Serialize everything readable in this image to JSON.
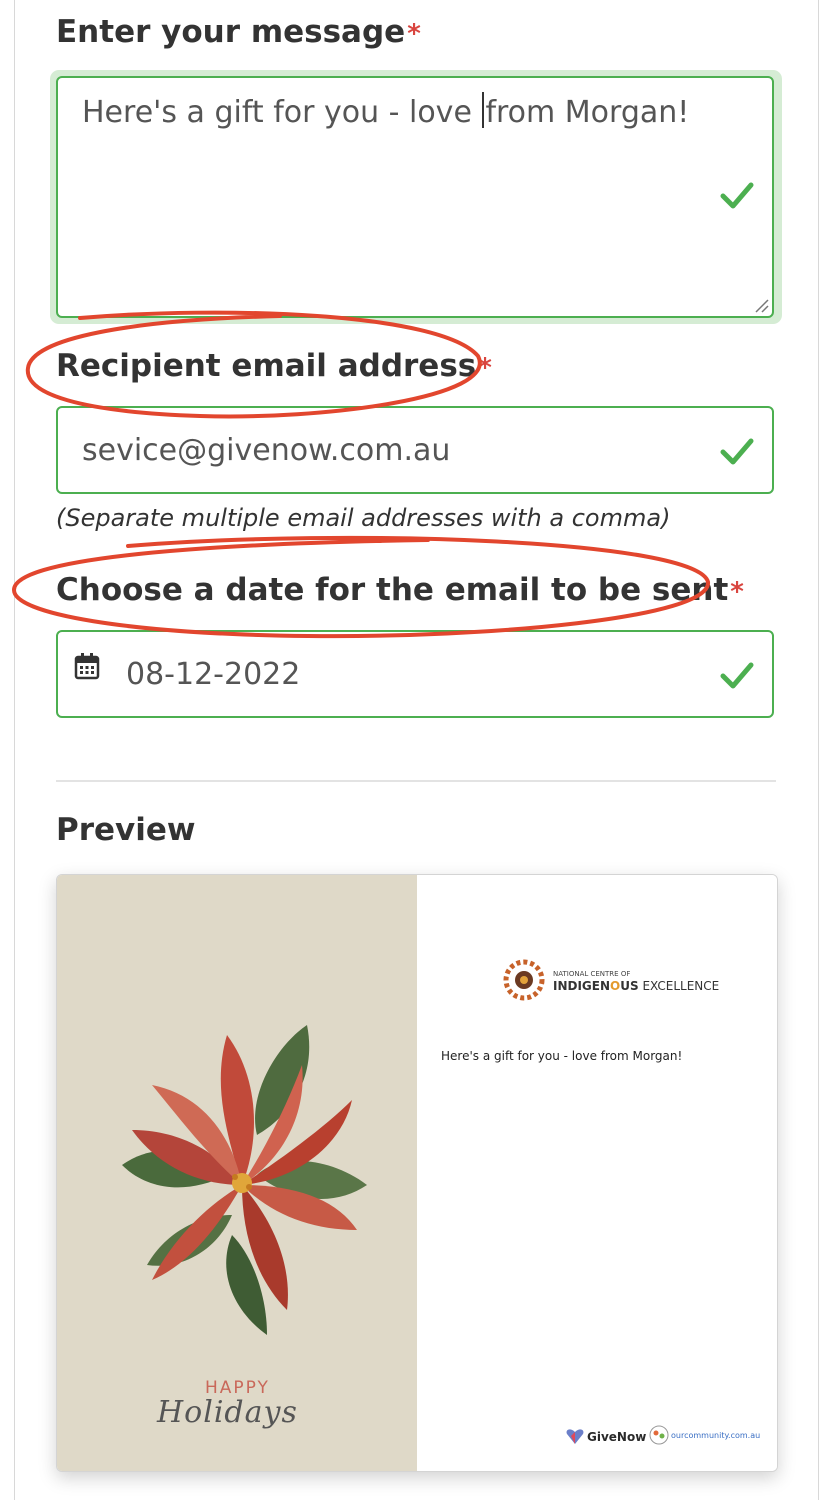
{
  "form": {
    "message": {
      "label": "Enter your message",
      "required_mark": "*",
      "value_before_caret": "Here's a gift for you - love ",
      "value_after_caret": "from Morgan!"
    },
    "recipient": {
      "label": "Recipient email address",
      "required_mark": "*",
      "value": "sevice@givenow.com.au",
      "hint": "(Separate multiple email addresses with a comma)"
    },
    "send_date": {
      "label": "Choose a date for the email to be sent",
      "required_mark": "*",
      "value": "08-12-2022"
    }
  },
  "preview": {
    "title": "Preview",
    "card": {
      "greeting_line1": "HAPPY",
      "greeting_line2": "Holidays",
      "message": "Here's a gift for you - love from Morgan!",
      "org_logo_small": "NATIONAL CENTRE OF",
      "org_logo_big_a": "INDIGEN",
      "org_logo_big_o": "O",
      "org_logo_big_b": "US",
      "org_logo_big_c": " EXCELLENCE",
      "footer_logo_1": "GiveNow",
      "footer_logo_2": "ourcommunity.com.au"
    }
  },
  "colors": {
    "valid": "#4caf50",
    "required": "#d9453f",
    "annotation": "#e2462e",
    "card_left_bg": "#dfd9c8"
  },
  "icons": [
    "check-icon",
    "calendar-icon",
    "resize-handle-icon",
    "poinsettia-illustration",
    "org-logo-icon"
  ]
}
